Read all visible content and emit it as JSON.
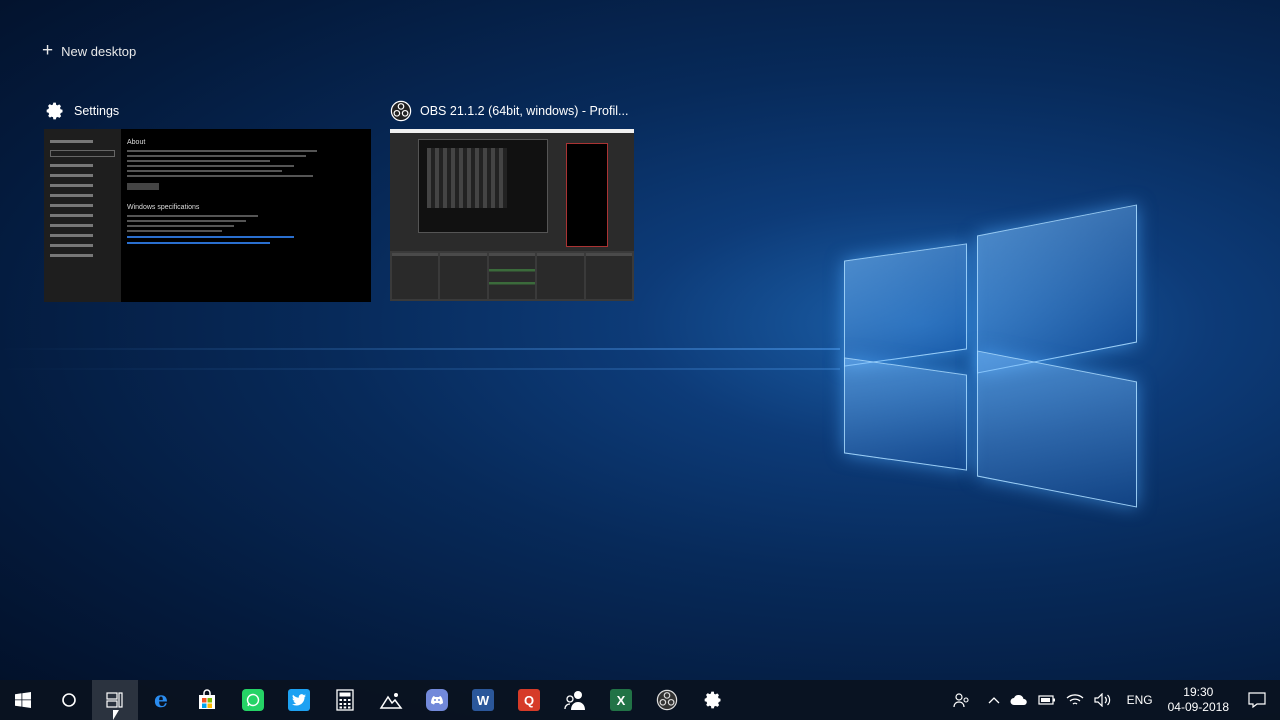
{
  "new_desktop": {
    "label": "New desktop"
  },
  "windows": [
    {
      "title": "Settings",
      "icon": "gear-icon"
    },
    {
      "title": "OBS 21.1.2 (64bit, windows) - Profil...",
      "icon": "obs-icon"
    }
  ],
  "settings_thumb": {
    "heading": "About",
    "subheading": "Windows specifications"
  },
  "taskbar": {
    "apps": [
      {
        "name": "start-button",
        "icon": "windows-icon"
      },
      {
        "name": "cortana-button",
        "icon": "circle-icon"
      },
      {
        "name": "task-view-button",
        "icon": "task-view-icon",
        "active": true
      },
      {
        "name": "edge-button",
        "icon": "edge-icon",
        "color": "#1f77d6",
        "glyph": "e"
      },
      {
        "name": "store-button",
        "icon": "store-icon",
        "color": "#ffffff"
      },
      {
        "name": "whatsapp-button",
        "icon": "whatsapp-icon",
        "color": "#25d366"
      },
      {
        "name": "twitter-button",
        "icon": "twitter-icon",
        "color": "#1da1f2"
      },
      {
        "name": "calculator-button",
        "icon": "calculator-icon",
        "color": "#555555"
      },
      {
        "name": "photos-button",
        "icon": "photos-icon",
        "color": "#ffffff"
      },
      {
        "name": "discord-button",
        "icon": "discord-icon",
        "color": "#7289da"
      },
      {
        "name": "word-button",
        "icon": "word-icon",
        "color": "#2b579a",
        "glyph": "W"
      },
      {
        "name": "quora-button",
        "icon": "quora-icon",
        "color": "#d63b28",
        "glyph": "Q"
      },
      {
        "name": "people-button",
        "icon": "people-icon",
        "color": "#ffffff"
      },
      {
        "name": "excel-button",
        "icon": "excel-icon",
        "color": "#217346",
        "glyph": "X"
      },
      {
        "name": "obs-button",
        "icon": "obs-icon",
        "color": "#333333"
      },
      {
        "name": "settings-button",
        "icon": "gear-icon",
        "color": "#ffffff"
      }
    ],
    "tray": {
      "language": "ENG",
      "time": "19:30",
      "date": "04-09-2018"
    }
  }
}
